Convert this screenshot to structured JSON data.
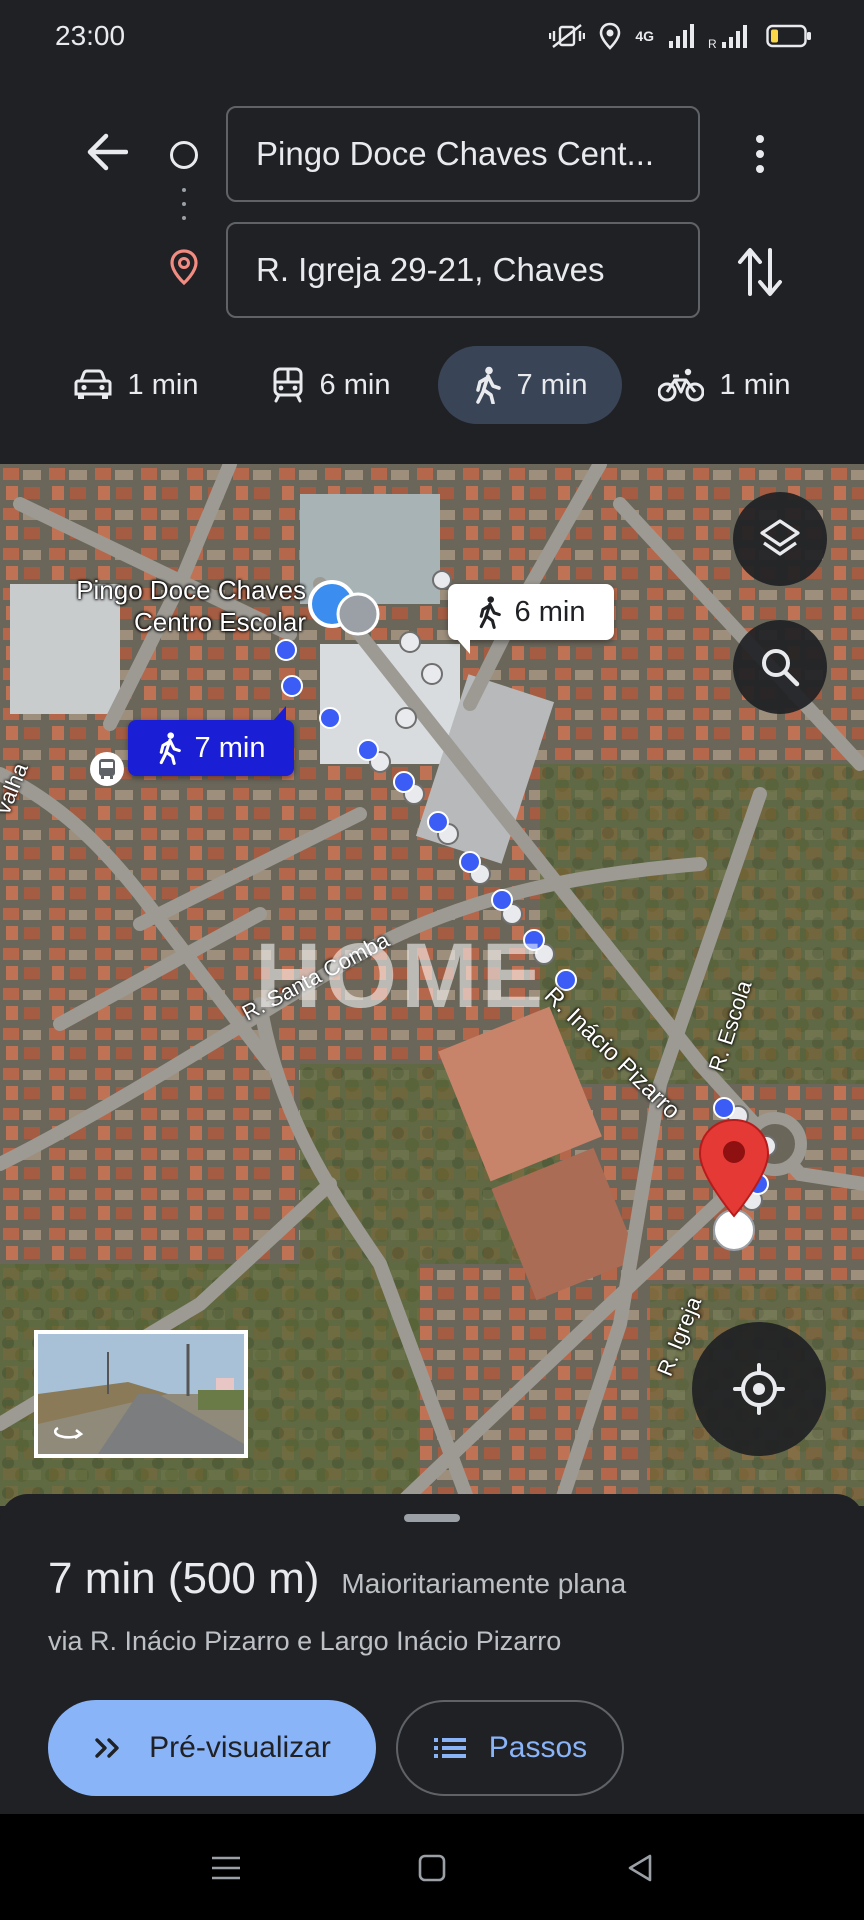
{
  "status_bar": {
    "time": "23:00",
    "network_label": "4G",
    "icons": [
      "vibrate-icon",
      "location-icon",
      "signal-4g-icon",
      "signal-roaming-icon",
      "battery-low-icon"
    ]
  },
  "directions": {
    "origin": "Pingo Doce Chaves Cent...",
    "destination": "R. Igreja 29-21, Chaves",
    "modes": [
      {
        "icon": "car-icon",
        "label": "1 min",
        "selected": false
      },
      {
        "icon": "transit-icon",
        "label": "6 min",
        "selected": false
      },
      {
        "icon": "walk-icon",
        "label": "7 min",
        "selected": true
      },
      {
        "icon": "bike-icon",
        "label": "1 min",
        "selected": false
      }
    ]
  },
  "map": {
    "place_label_line1": "Pingo Doce Chaves",
    "place_label_line2": "Centro Escolar",
    "alt_route_bubble": "6 min",
    "main_route_bubble": "7 min",
    "streets": {
      "santa_comba": "R. Santa Comba",
      "inacio_pizarro": "R. Inácio Pizarro",
      "escola": "R. Escola",
      "igreja": "R. Igreja",
      "valha": "valha"
    },
    "watermark": "HOME",
    "colors": {
      "route_blue": "#3b5df5",
      "alt_route": "#e8eaed",
      "pin_red": "#e53935"
    }
  },
  "sheet": {
    "duration": "7 min (500 m)",
    "terrain": "Maioritariamente plana",
    "via": "via R. Inácio Pizarro e Largo Inácio Pizarro",
    "preview_label": "Pré-visualizar",
    "steps_label": "Passos",
    "accent": "#8ab4f8"
  }
}
